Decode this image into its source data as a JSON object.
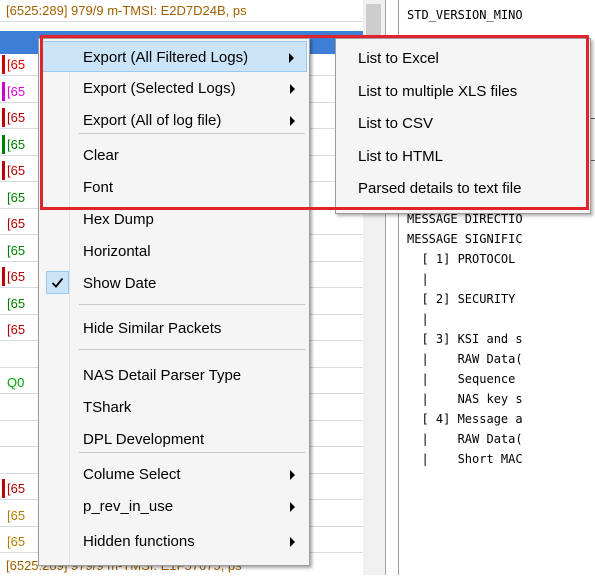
{
  "log_list": {
    "header_row": "[6525:289] 979/9 m-TMSI: E2D7D24B, ps",
    "footer_row": "[6525:289] 979/9 m-TMSI: E1F57675, ps",
    "rows": [
      {
        "text": "[65",
        "color": "#e00000",
        "mark": "#d00000"
      },
      {
        "text": "[65",
        "color": "#e000e0",
        "mark": "#d000d0"
      },
      {
        "text": "[65",
        "color": "#b00000",
        "mark": "#c00000"
      },
      {
        "text": "[65",
        "color": "#008000",
        "mark": "#008000"
      },
      {
        "text": "[65",
        "color": "#b00000",
        "mark": "#c00000"
      },
      {
        "text": "[65",
        "color": "#008000",
        "mark": "#ffffff"
      },
      {
        "text": "[65",
        "color": "#b00000",
        "mark": "#ffffff"
      },
      {
        "text": "[65",
        "color": "#008000",
        "mark": "#ffffff"
      },
      {
        "text": "[65",
        "color": "#b00000",
        "mark": "#c00000"
      },
      {
        "text": "[65",
        "color": "#008000",
        "mark": "#ffffff"
      },
      {
        "text": "[65",
        "color": "#b00000",
        "mark": "#ffffff"
      },
      {
        "text": "",
        "color": "#000000",
        "mark": "#ffffff"
      },
      {
        "text": "Q0",
        "color": "#00a000",
        "mark": "#ffffff"
      },
      {
        "text": "",
        "color": "#000000",
        "mark": "#ffffff"
      },
      {
        "text": "",
        "color": "#000000",
        "mark": "#ffffff"
      },
      {
        "text": "",
        "color": "#000000",
        "mark": "#ffffff"
      },
      {
        "text": "[65",
        "color": "#b00000",
        "mark": "#c00000"
      },
      {
        "text": "[65",
        "color": "#b08000",
        "mark": "#ffffff"
      },
      {
        "text": "[65",
        "color": "#b08000",
        "mark": "#ffffff"
      }
    ]
  },
  "detail": {
    "lines": [
      "STD_VERSION_MINO",
      "",
      "",
      "",
      "",
      "",
      "",
      "",
      "",
      "",
      "MESSAGE DIRECTIO",
      "MESSAGE SIGNIFIC",
      "  [ 1] PROTOCOL ",
      "  |",
      "  [ 2] SECURITY ",
      "  |",
      "  [ 3] KSI and s",
      "  |    RAW Data(",
      "  |    Sequence ",
      "  |    NAS key s",
      "  [ 4] Message a",
      "  |    RAW Data(",
      "  |    Short MAC"
    ]
  },
  "context_menu": {
    "items": [
      {
        "label": "Export (All Filtered Logs)",
        "submenu": true,
        "highlighted": true
      },
      {
        "label": "Export (Selected Logs)",
        "submenu": true
      },
      {
        "label": "Export (All of log file)",
        "submenu": true
      },
      {
        "label": "Clear"
      },
      {
        "label": "Font"
      },
      {
        "label": "Hex Dump"
      },
      {
        "label": "Horizontal"
      },
      {
        "label": "Show Date",
        "checked": true
      },
      {
        "label": "Hide Similar Packets"
      },
      {
        "label": "NAS Detail Parser Type"
      },
      {
        "label": "TShark"
      },
      {
        "label": "DPL Development"
      },
      {
        "label": "Colume Select",
        "submenu": true
      },
      {
        "label": "p_rev_in_use",
        "submenu": true
      },
      {
        "label": "Hidden functions",
        "submenu": true
      }
    ]
  },
  "export_submenu": {
    "items": [
      "List to Excel",
      "List to multiple XLS files",
      "List to CSV",
      "List to HTML",
      "Parsed details to text file"
    ]
  },
  "colors": {
    "highlight_frame": "#e0242c",
    "menu_hover": "#cce4f7",
    "selected_row": "#3d7fd6"
  }
}
